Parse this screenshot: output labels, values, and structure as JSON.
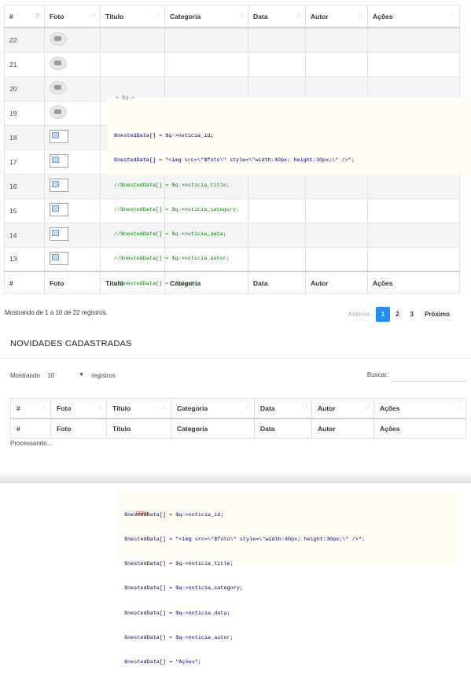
{
  "table1": {
    "headers": [
      "#",
      "Foto",
      "Título",
      "Categoria",
      "Data",
      "Autor",
      "Ações"
    ],
    "rows": [
      {
        "id": "22",
        "foto": "placeholder"
      },
      {
        "id": "21",
        "foto": "placeholder"
      },
      {
        "id": "20",
        "foto": "placeholder"
      },
      {
        "id": "19",
        "foto": "placeholder"
      },
      {
        "id": "18",
        "foto": "broken"
      },
      {
        "id": "17",
        "foto": "broken"
      },
      {
        "id": "16",
        "foto": "broken"
      },
      {
        "id": "15",
        "foto": "broken"
      },
      {
        "id": "14",
        "foto": "broken"
      },
      {
        "id": "13",
        "foto": "broken"
      }
    ],
    "footers": [
      "#",
      "Foto",
      "Título",
      "Categoria",
      "Data",
      "Autor",
      "Ações"
    ]
  },
  "code_lines": [
    "$nestedData[] = $q->noticia_id;",
    "$nestedData[] = \"<img src=\\\"$foto\\\" style=\\\"width:40px; height:30px;\\\" />\";",
    "//$nestedData[] = $q->noticia_title;",
    "//$nestedData[] = $q->noticia_category;",
    "//$nestedData[] = $q->noticia_data;",
    "//$nestedData[] = $q->noticia_autor;",
    "//$nestedData[] = \"Ações\";"
  ],
  "info_text": "Mostrando de 1 a 10 de 22 registros.",
  "pagination": {
    "previous": "Anterior",
    "pages": [
      "1",
      "2",
      "3"
    ],
    "active": "1",
    "next": "Próximo"
  },
  "section_title": "NOVIDADES CADASTRADAS",
  "length_control": {
    "prefix": "Mostrando",
    "value": "10",
    "suffix": "registros"
  },
  "search_label": "Buscar:",
  "table2": {
    "headers": [
      "#",
      "Foto",
      "Título",
      "Categoria",
      "Data",
      "Autor",
      "Ações"
    ],
    "footers": [
      "#",
      "Foto",
      "Título",
      "Categoria",
      "Data",
      "Autor",
      "Ações"
    ]
  },
  "processing_text": "Processando...",
  "code2_lines": [
    "$nestedData[] = $q->noticia_id;",
    "$nestedData[] = \"<img src=\\\"$foto\\\" style=\\\"width:40px; height:30px;\\\" />\";",
    "$nestedData[] = $q->noticia_title;",
    "$nestedData[] = $q->noticia_category;",
    "$nestedData[] = $q->noticia_data;",
    "$nestedData[] = $q->noticia_autor;",
    "$nestedData[] = \"Ações\";"
  ],
  "error_label": "ERRO"
}
